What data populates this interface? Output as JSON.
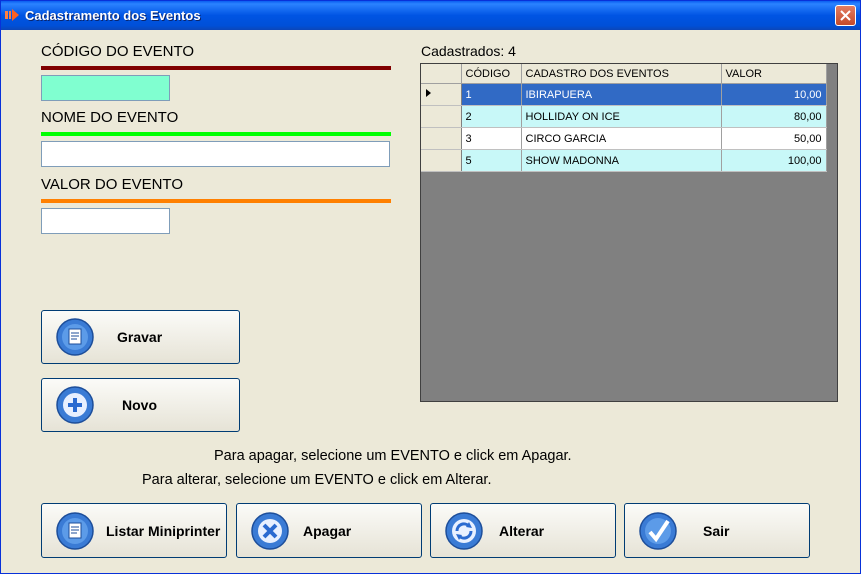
{
  "window": {
    "title": "Cadastramento dos Eventos"
  },
  "form": {
    "codigo_label": "CÓDIGO DO EVENTO",
    "nome_label": "NOME DO EVENTO",
    "valor_label": "VALOR DO EVENTO",
    "codigo_value": "",
    "nome_value": "",
    "valor_value": ""
  },
  "list": {
    "count_text": "Cadastrados: 4",
    "columns": [
      "CÓDIGO",
      "CADASTRO DOS EVENTOS",
      "VALOR"
    ],
    "rows": [
      {
        "codigo": "1",
        "nome": "IBIRAPUERA",
        "valor": "10,00"
      },
      {
        "codigo": "2",
        "nome": "HOLLIDAY ON ICE",
        "valor": "80,00"
      },
      {
        "codigo": "3",
        "nome": "CIRCO GARCIA",
        "valor": "50,00"
      },
      {
        "codigo": "5",
        "nome": "SHOW MADONNA",
        "valor": "100,00"
      }
    ]
  },
  "buttons": {
    "gravar": "Gravar",
    "novo": "Novo",
    "listar": "Listar Miniprinter",
    "apagar": "Apagar",
    "alterar": "Alterar",
    "sair": "Sair"
  },
  "hints": {
    "apagar": "Para apagar, selecione um EVENTO e click em Apagar.",
    "alterar": "Para alterar, selecione um EVENTO e click em Alterar."
  },
  "colors": {
    "codigo_rule": "#800000",
    "nome_rule": "#00ff00",
    "valor_rule": "#ff8000",
    "codigo_input_bg": "#80ffd0",
    "selected_row": "#316ac5",
    "alt_row": "#c8f8f8"
  }
}
